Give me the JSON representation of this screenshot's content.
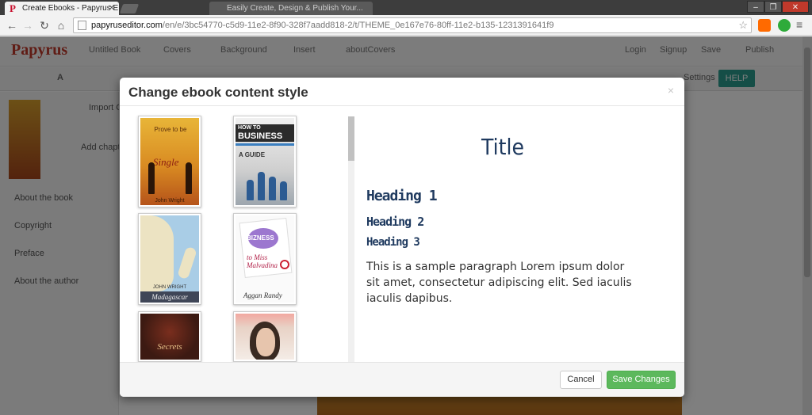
{
  "browser": {
    "active_tab": {
      "title": "Create Ebooks - Papyrus E",
      "favicon": "P"
    },
    "inactive_tab": {
      "title": "Easily Create, Design & Publish Your..."
    },
    "url_domain": "papyruseditor.com",
    "url_path": "/en/e/3bc54770-c5d9-11e2-8f90-328f7aadd818-2/t/THEME_0e167e76-80ff-11e2-b135-1231391641f9",
    "window_controls": [
      "minimize-icon",
      "maximize-icon",
      "close-icon"
    ],
    "extensions": [
      "soundcloud-icon",
      "evernote-icon"
    ]
  },
  "app": {
    "brand": "Papyrus",
    "nav": [
      "Untitled Book",
      "Covers",
      "Background",
      "Insert",
      "aboutCovers"
    ],
    "nav_right": [
      "Login",
      "Signup",
      "Save",
      "Publish"
    ],
    "editbar": [
      "A",
      "Settings",
      "HELP"
    ],
    "sidebar": {
      "import_label": "Import C",
      "add_chapter": "Add chapter",
      "items": [
        "About the book",
        "Copyright",
        "Preface",
        "About the author"
      ]
    }
  },
  "modal": {
    "title": "Change ebook content style",
    "close": "×",
    "themes": [
      {
        "name": "single",
        "cover_text": "Prove to be",
        "word": "Single",
        "author": "John Wright"
      },
      {
        "name": "business",
        "line1": "HOW TO",
        "line2": "BUSINESS",
        "guide": "A GUIDE"
      },
      {
        "name": "madagascar",
        "subtitle": "JOHN WRIGHT",
        "title": "Madagascar"
      },
      {
        "name": "bizness",
        "word": "BIZNESS",
        "to": "to Miss Malvadina",
        "author": "Aggan Randy"
      },
      {
        "name": "secrets",
        "word": "Secrets"
      },
      {
        "name": "portrait"
      }
    ],
    "preview": {
      "title": "Title",
      "heading1": "Heading 1",
      "heading2": "Heading 2",
      "heading3": "Heading 3",
      "paragraph": "This is a sample paragraph Lorem ipsum dolor sit amet, consectetur adipiscing elit. Sed iaculis iaculis dapibus."
    },
    "buttons": {
      "cancel": "Cancel",
      "save": "Save Changes"
    },
    "colors": {
      "heading": "#1f3a5f",
      "save": "#5cb85c"
    }
  }
}
